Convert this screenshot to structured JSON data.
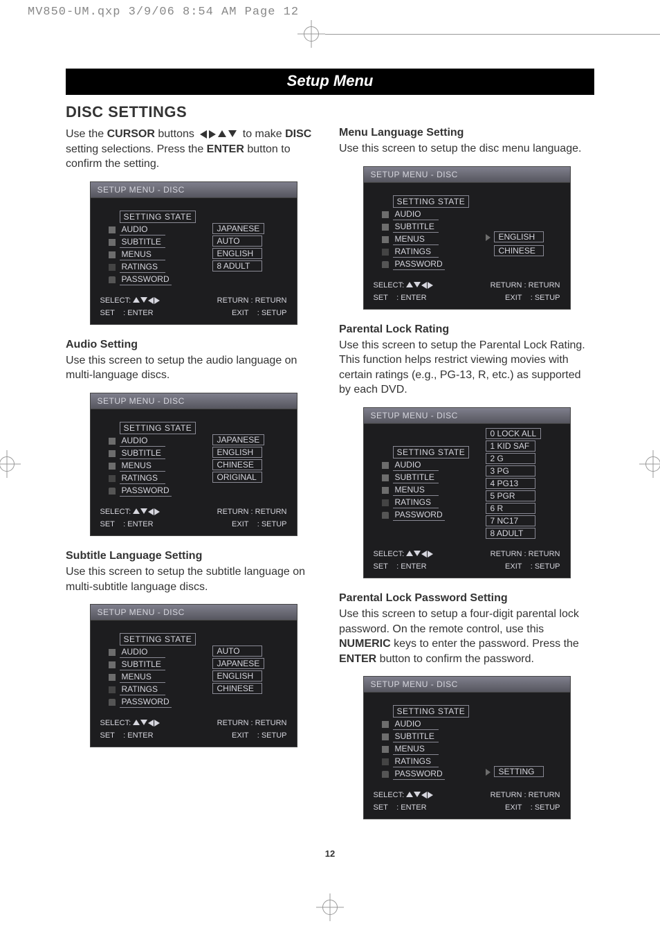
{
  "header": {
    "slug": "MV850-UM.qxp  3/9/06  8:54 AM  Page 12"
  },
  "banner": "Setup Menu",
  "pagenum": "12",
  "intro_heading": "DISC SETTINGS",
  "intro_pre": "Use the ",
  "intro_cursor": "CURSOR",
  "intro_mid": " buttons ",
  "intro_post1": " to make ",
  "intro_disc": "DISC",
  "intro_line2a": "setting selections. Press the ",
  "intro_enter": "ENTER",
  "intro_line2b": " button to confirm the setting.",
  "osd_title": "SETUP MENU - DISC",
  "osd_left_head": "SETTING STATE",
  "osd_left_items": [
    "AUDIO",
    "SUBTITLE",
    "MENUS",
    "RATINGS",
    "PASSWORD"
  ],
  "osd_footer": {
    "select": "SELECT:",
    "return": "RETURN : RETURN",
    "set": "SET",
    "enter": ": ENTER",
    "exit": "EXIT",
    "setup": ": SETUP"
  },
  "osd1_vals": [
    "JAPANESE",
    "AUTO",
    "ENGLISH",
    "8  ADULT"
  ],
  "audio": {
    "heading": "Audio Setting",
    "body": "Use this screen to setup the audio language on multi-language discs.",
    "vals": [
      "JAPANESE",
      "ENGLISH",
      "CHINESE",
      "ORIGINAL"
    ]
  },
  "subtitle": {
    "heading": "Subtitle Language Setting",
    "body": "Use this screen to setup the subtitle language on multi-subtitle language discs.",
    "vals": [
      "AUTO",
      "JAPANESE",
      "ENGLISH",
      "CHINESE"
    ]
  },
  "menulang": {
    "heading": "Menu Language Setting",
    "body": "Use this screen to setup the disc menu language.",
    "vals": [
      "ENGLISH",
      "CHINESE"
    ]
  },
  "rating": {
    "heading": "Parental Lock Rating",
    "body": "Use this screen to setup the Parental Lock Rating. This function helps restrict viewing movies with certain ratings (e.g., PG-13, R, etc.) as supported by each DVD.",
    "vals": [
      "0 LOCK ALL",
      "1 KID SAF",
      "2 G",
      "3 PG",
      "4 PG13",
      "5 PGR",
      "6 R",
      "7 NC17",
      "8 ADULT"
    ]
  },
  "password": {
    "heading": "Parental Lock Password Setting",
    "body_a": "Use this screen to setup a four-digit parental lock password. On the remote control, use this ",
    "body_num": "NUMERIC",
    "body_b": " keys to enter the password. Press the ",
    "body_enter": "ENTER",
    "body_c": " button to confirm the password.",
    "vals": [
      "SETTING"
    ]
  }
}
